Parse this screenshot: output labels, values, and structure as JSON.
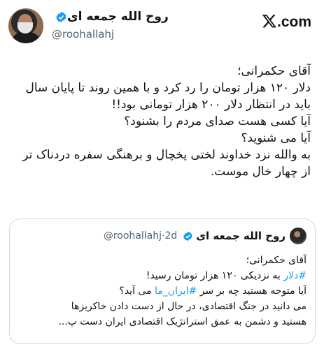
{
  "author": {
    "display_name": "روح الله جمعه ای",
    "handle": "@roohallahj",
    "verified": true
  },
  "brand": {
    "logo": "x-logo",
    "suffix": ".com"
  },
  "tweet": {
    "lines": [
      "آقای حکمرانی؛",
      "دلار ۱۲۰ هزار تومان را رد کرد و با همین روند تا پایان سال",
      "باید در انتظار دلار ۲۰۰ هزار تومانی بود!!",
      "آیا کسی هست صدای مردم را بشنود؟",
      "آیا می شنوید؟",
      "به والله نزد خداوند لختی یخچال و برهنگی سفره دردناک تر",
      "از چهار خال موست."
    ]
  },
  "quote": {
    "display_name": "روح الله جمعه ای",
    "handle": "@roohallahj",
    "separator": "·",
    "age": "2d",
    "line1": "آقای حکمرانی؛",
    "line2_hashtag": "#دلار",
    "line2_rest": " به نزدیکی ۱۲۰ هزار تومان رسید!",
    "line3_start": "آیا متوجه هستید چه بر سر ",
    "line3_hashtag": "#ایران_ما",
    "line3_end": " می آید؟",
    "line4": "می دانید در جنگ اقتصادی، در حال از دست دادن خاکریزها",
    "line5": "هستید و دشمن به عمق استراتژیک اقتصادی ایران دست پ..."
  },
  "colors": {
    "accent": "#1d9bf0",
    "text": "#0f1419",
    "muted": "#536471",
    "border": "#cfd9de"
  }
}
